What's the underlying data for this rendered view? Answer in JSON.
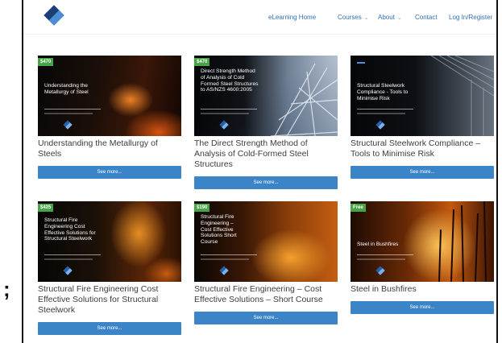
{
  "header": {
    "nav": [
      {
        "label": "eLearning Home",
        "dropdown": false
      },
      {
        "label": "Courses",
        "dropdown": true
      },
      {
        "label": "About",
        "dropdown": true
      },
      {
        "label": "Contact",
        "dropdown": false
      },
      {
        "label": "Log In/Register",
        "dropdown": false
      }
    ]
  },
  "courses": [
    {
      "price": "$470",
      "image_text": "Understanding the Metallurgy of Steel",
      "title": "Understanding the Metallurgy of Steels",
      "button": "See more..."
    },
    {
      "price": "$470",
      "image_text": "Direct Strength Method of Analysis of Cold Formed Steel Structures to AS/NZS 4600:2005",
      "title": "The Direct Strength Method of Analysis of Cold-Formed Steel Structures",
      "button": "See more..."
    },
    {
      "price": "",
      "image_text": "Structural Steelwork Compliance - Tools to Minimise Risk",
      "title": "Structural Steelwork Compliance – Tools to Minimise Risk",
      "button": "See more..."
    },
    {
      "price": "$425",
      "image_text": "Structural Fire Engineering Cost Effective Solutions for Structural Steelwork",
      "title": "Structural Fire Engineering Cost Effective Solutions for Structural Steelwork",
      "button": "See more..."
    },
    {
      "price": "$190",
      "image_text": "Structural Fire Engineering – Cost Effective Solutions Short Course",
      "title": "Structural Fire Engineering – Cost Effective Solutions – Short Course",
      "button": "See more..."
    },
    {
      "price": "Free",
      "image_text": "Steel in Bushfires",
      "title": "Steel in Bushfires",
      "button": "See more..."
    }
  ],
  "colors": {
    "accent": "#3b84c8",
    "price_badge": "#47a447",
    "nav_link": "#2f6fb6"
  }
}
